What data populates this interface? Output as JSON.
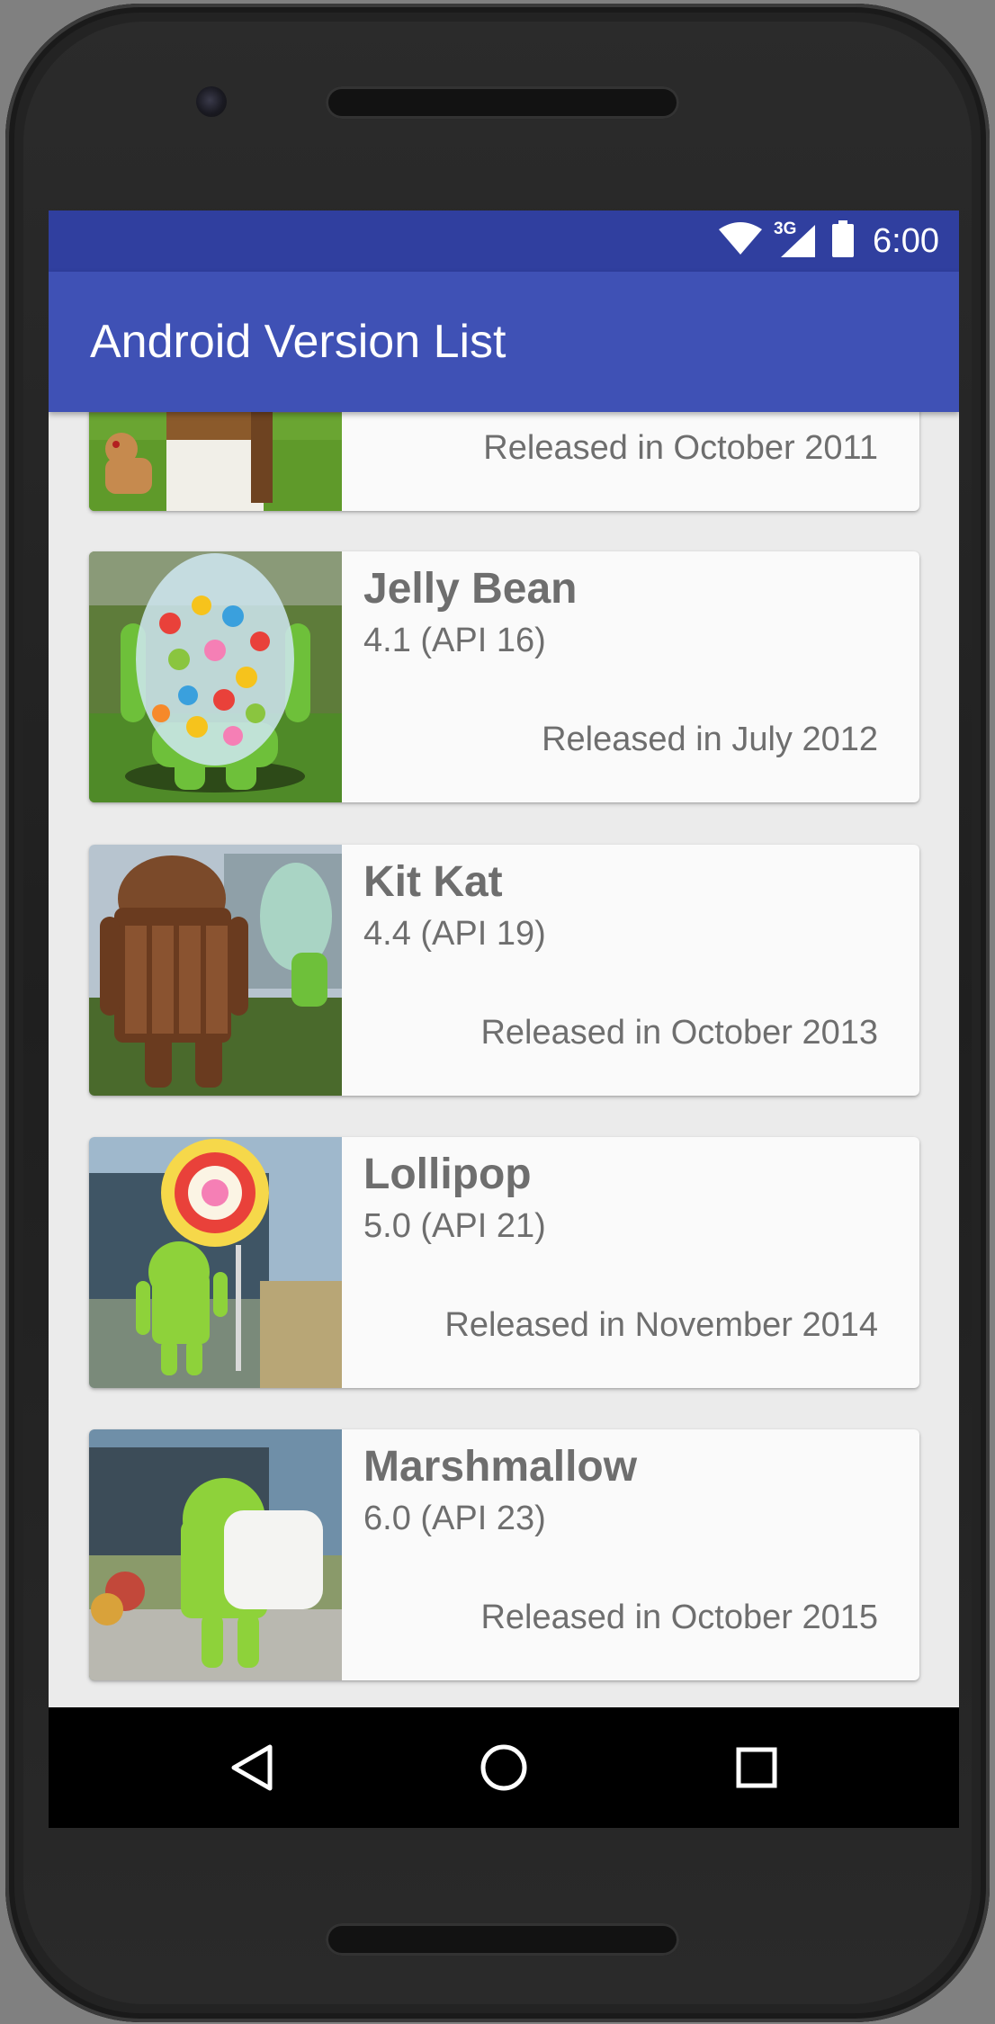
{
  "status_bar": {
    "network": "3G",
    "time": "6:00",
    "icons": [
      "wifi-icon",
      "cell-signal-icon",
      "battery-icon"
    ]
  },
  "app_bar": {
    "title": "Android Version List"
  },
  "versions": [
    {
      "name": "",
      "api": "",
      "released": "Released in October 2011",
      "image": "ice-cream-sandwich-statue"
    },
    {
      "name": "Jelly Bean",
      "api": "4.1 (API 16)",
      "released": "Released in July 2012",
      "image": "jelly-bean-statue"
    },
    {
      "name": "Kit Kat",
      "api": "4.4 (API 19)",
      "released": "Released in October 2013",
      "image": "kit-kat-statue"
    },
    {
      "name": "Lollipop",
      "api": "5.0 (API 21)",
      "released": "Released in November 2014",
      "image": "lollipop-statue"
    },
    {
      "name": "Marshmallow",
      "api": "6.0 (API 23)",
      "released": "Released in October 2015",
      "image": "marshmallow-statue"
    }
  ],
  "nav_bar": {
    "buttons": [
      "back-icon",
      "home-icon",
      "recents-icon"
    ]
  },
  "colors": {
    "status_bar": "#303f9f",
    "app_bar": "#3f51b5",
    "card_text": "#6e6e6e",
    "background": "#ebebeb"
  }
}
